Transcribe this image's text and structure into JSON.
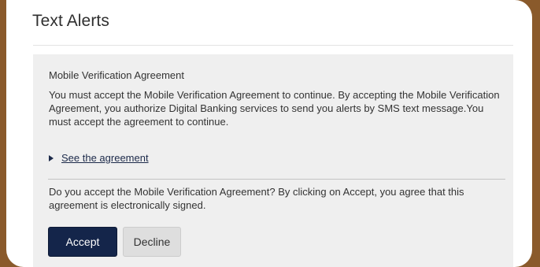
{
  "dialog": {
    "title": "Text Alerts"
  },
  "agreement": {
    "heading": "Mobile Verification Agreement",
    "body": "You must accept the Mobile Verification Agreement to continue. By accepting the Mobile Verification Agreement, you authorize Digital Banking services to send you alerts by SMS text message.You must accept the agreement to continue.",
    "toggle_link": "See the agreement",
    "question": "Do you accept the Mobile Verification Agreement? By clicking on Accept, you agree that this agreement is electronically signed."
  },
  "actions": {
    "accept_label": "Accept",
    "decline_label": "Decline"
  },
  "colors": {
    "primary": "#14254a",
    "panel_bg": "#efefef",
    "outer_frame": "#8a5a2b"
  }
}
